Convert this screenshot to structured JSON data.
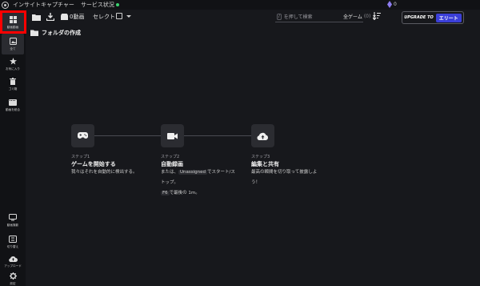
{
  "titlebar": {
    "app_title": "インサイトキャプチャー",
    "service_status": "サービス状況",
    "gems": "0"
  },
  "sidebar": {
    "items": [
      {
        "label": "動画動画",
        "icon": "grid-icon"
      },
      {
        "label": "全て",
        "icon": "photo-icon"
      },
      {
        "label": "お気に入り",
        "icon": "star-icon"
      },
      {
        "label": "ゴミ箱",
        "icon": "trash-icon"
      },
      {
        "label": "動画を統合",
        "icon": "film-icon"
      },
      {
        "label": "動画撮影",
        "icon": "monitor-icon"
      },
      {
        "label": "切り替え",
        "icon": "switch-icon"
      },
      {
        "label": "アップロード",
        "icon": "cloud-upload-icon"
      },
      {
        "label": "設定",
        "icon": "gear-icon"
      }
    ]
  },
  "toolbar": {
    "video_count_label": "0動画",
    "select_label": "セレクト",
    "search_kbd": "/",
    "search_placeholder": "を押して検索",
    "filter_label": "全ゲーム",
    "filter_count": "(0)",
    "upgrade_label": "UPGRADE TO",
    "elite_label": "エリート"
  },
  "folder_create": {
    "label": "フォルダの作成"
  },
  "steps": [
    {
      "num": "ステップ1",
      "title": "ゲームを開始する",
      "icon": "gamepad-icon",
      "desc_line1": "我々はそれを自動的に検出する。"
    },
    {
      "num": "ステップ2",
      "title": "自動録画",
      "icon": "video-camera-icon",
      "desc_pre": "または、",
      "desc_key1": "Unassigned",
      "desc_mid": "でスタート/ス",
      "desc_line2": "トップ。",
      "desc_key2": "F6",
      "desc_post": "で最後の 1m。"
    },
    {
      "num": "ステップ3",
      "title": "編集と共有",
      "icon": "cloud-upload-icon",
      "desc_line1": "最高の瞬間を切り取って披露しよ",
      "desc_line2": "う！"
    }
  ],
  "colors": {
    "background": "#17181c",
    "sidebar": "#111215",
    "accent": "#3b3fd8",
    "status_ok": "#3bd16f",
    "highlight": "#ff0000"
  }
}
